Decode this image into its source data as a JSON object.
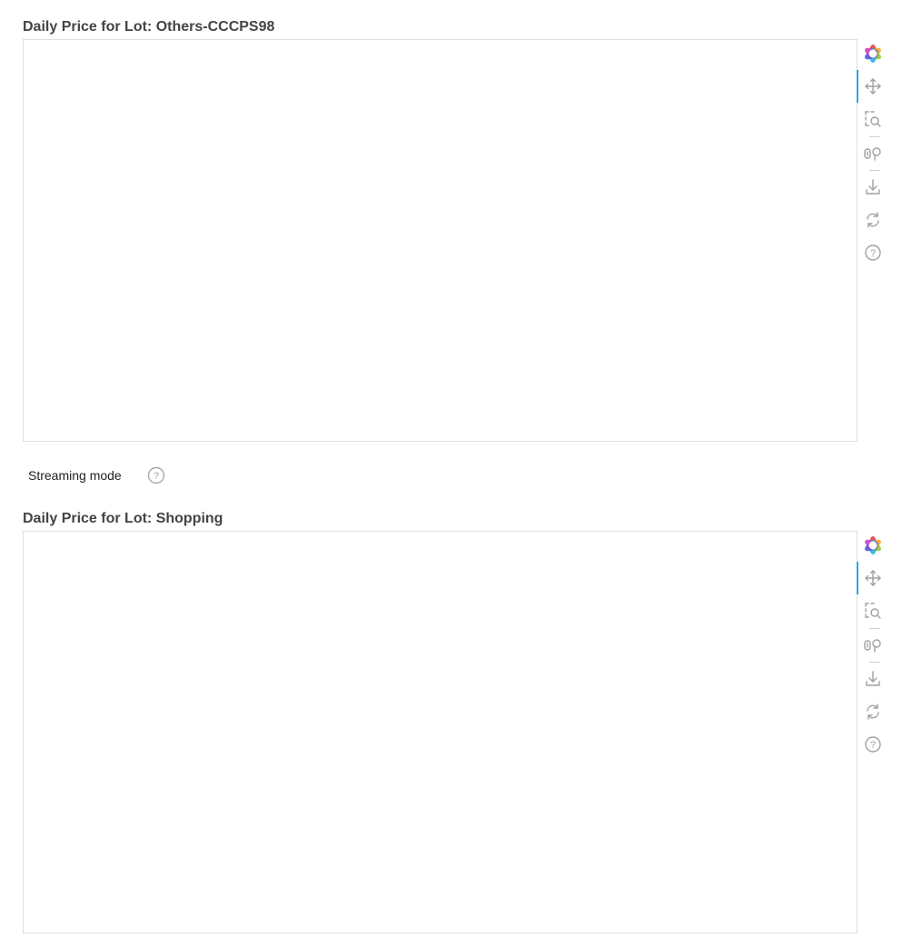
{
  "plots": [
    {
      "title": "Daily Price for Lot: Others-CCCPS98",
      "toolbar": {
        "logo": "bokeh-logo-icon",
        "tools": [
          {
            "name": "pan-tool",
            "icon": "pan-icon",
            "active": true
          },
          {
            "name": "box-zoom-tool",
            "icon": "box-zoom-icon",
            "active": false
          },
          {
            "name": "hover-tool",
            "icon": "hover-icon",
            "active": false
          },
          {
            "name": "save-tool",
            "icon": "save-icon",
            "active": false
          },
          {
            "name": "reset-tool",
            "icon": "reset-icon",
            "active": false
          },
          {
            "name": "help-tool",
            "icon": "help-icon",
            "active": false
          }
        ]
      }
    },
    {
      "title": "Daily Price for Lot: Shopping",
      "toolbar": {
        "logo": "bokeh-logo-icon",
        "tools": [
          {
            "name": "pan-tool",
            "icon": "pan-icon",
            "active": true
          },
          {
            "name": "box-zoom-tool",
            "icon": "box-zoom-icon",
            "active": false
          },
          {
            "name": "hover-tool",
            "icon": "hover-icon",
            "active": false
          },
          {
            "name": "save-tool",
            "icon": "save-icon",
            "active": false
          },
          {
            "name": "reset-tool",
            "icon": "reset-icon",
            "active": false
          },
          {
            "name": "help-tool",
            "icon": "help-icon",
            "active": false
          }
        ]
      }
    }
  ],
  "streaming": {
    "label": "Streaming mode",
    "help_icon": "help-icon"
  },
  "colors": {
    "active_tool_accent": "#26aae1",
    "icon_gray": "#a0a0a0",
    "border": "#e0e0e0"
  }
}
